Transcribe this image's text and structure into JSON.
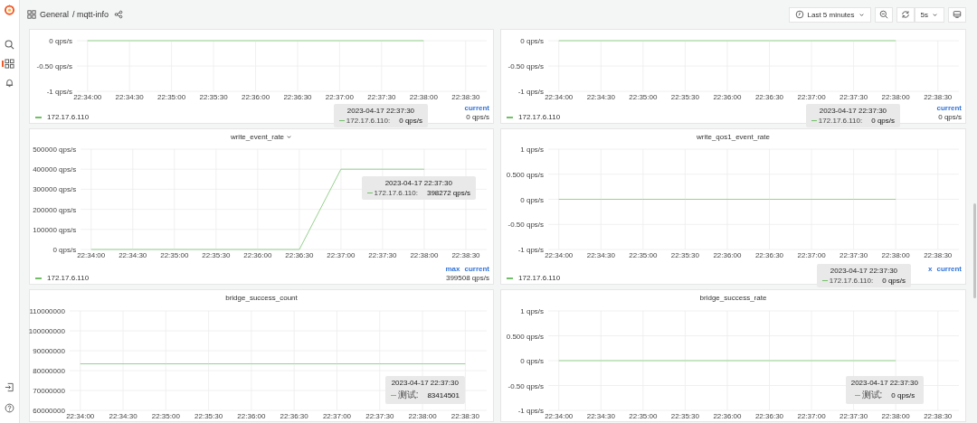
{
  "sidebar": {
    "items": [
      {
        "kind": "search",
        "selected": false
      },
      {
        "kind": "dashboards",
        "selected": true
      },
      {
        "kind": "alerting",
        "selected": false
      }
    ],
    "bottom_items": [
      {
        "kind": "sign-in"
      },
      {
        "kind": "help"
      }
    ]
  },
  "breadcrumb": {
    "folder": "General",
    "dashboard": "/ mqtt-info"
  },
  "toolbar": {
    "time_range": "Last 5 minutes",
    "refresh_interval": "5s"
  },
  "panels": [
    {
      "chart_data": {
        "type": "line",
        "grid": true,
        "categories": [
          "22:34:00",
          "22:34:30",
          "22:35:00",
          "22:35:30",
          "22:36:00",
          "22:36:30",
          "22:37:00",
          "22:37:30",
          "22:38:00",
          "22:38:30"
        ],
        "series": [
          {
            "name": "172.17.6.110",
            "color": "#96d18e",
            "values": [
              0,
              0,
              0,
              0,
              0,
              0,
              0,
              0,
              0,
              null
            ]
          }
        ],
        "ylim": [
          -1,
          0
        ],
        "yticks": [
          {
            "value": 0,
            "label": "0 qps/s"
          },
          {
            "value": -0.5,
            "label": "-0.50 qps/s"
          },
          {
            "value": -1,
            "label": "-1 qps/s"
          }
        ]
      },
      "legend": {
        "color": "#73bf69",
        "headers": [
          "current"
        ],
        "values": [
          "0 qps/s"
        ]
      },
      "tooltip": {
        "time": "2023-04-17 22:37:30",
        "label": "172.17.6.110:",
        "value": "0 qps/s"
      }
    },
    {
      "chart_data": {
        "type": "line",
        "grid": true,
        "categories": [
          "22:34:00",
          "22:34:30",
          "22:35:00",
          "22:35:30",
          "22:36:00",
          "22:36:30",
          "22:37:00",
          "22:37:30",
          "22:38:00",
          "22:38:30"
        ],
        "series": [
          {
            "name": "172.17.6.110",
            "color": "#96d18e",
            "values": [
              0,
              0,
              0,
              0,
              0,
              0,
              0,
              0,
              0,
              null
            ]
          }
        ],
        "ylim": [
          -1,
          0
        ],
        "yticks": [
          {
            "value": 0,
            "label": "0 qps/s"
          },
          {
            "value": -0.5,
            "label": "-0.50 qps/s"
          },
          {
            "value": -1,
            "label": "-1 qps/s"
          }
        ]
      },
      "legend": {
        "color": "#73bf69",
        "headers": [
          "current"
        ],
        "values": [
          "0 qps/s"
        ]
      },
      "tooltip": {
        "time": "2023-04-17 22:37:30",
        "label": "172.17.6.110:",
        "value": "0 qps/s"
      }
    },
    {
      "title": "write_event_rate",
      "hovered": true,
      "chart_data": {
        "type": "line",
        "grid": true,
        "categories": [
          "22:34:00",
          "22:34:30",
          "22:35:00",
          "22:35:30",
          "22:36:00",
          "22:36:30",
          "22:37:00",
          "22:37:30",
          "22:38:00",
          "22:38:30"
        ],
        "series": [
          {
            "name": "172.17.6.110",
            "color": "#96d18e",
            "values": [
              0,
              0,
              0,
              0,
              0,
              0,
              400000,
              400000,
              400000,
              null
            ]
          }
        ],
        "ylim": [
          0,
          500000
        ],
        "yticks": [
          {
            "value": 500000,
            "label": "500000 qps/s"
          },
          {
            "value": 400000,
            "label": "400000 qps/s"
          },
          {
            "value": 300000,
            "label": "300000 qps/s"
          },
          {
            "value": 200000,
            "label": "200000 qps/s"
          },
          {
            "value": 100000,
            "label": "100000 qps/s"
          },
          {
            "value": 0,
            "label": "0 qps/s"
          }
        ]
      },
      "legend": {
        "color": "#73bf69",
        "headers": [
          "max",
          "current"
        ],
        "values": [
          "399508 qps/s"
        ]
      },
      "tooltip": {
        "time": "2023-04-17 22:37:30",
        "label": "172.17.6.110:",
        "value": "398272 qps/s"
      }
    },
    {
      "title": "write_qos1_event_rate",
      "hovered": false,
      "chart_data": {
        "type": "line",
        "grid": true,
        "categories": [
          "22:34:00",
          "22:34:30",
          "22:35:00",
          "22:35:30",
          "22:36:00",
          "22:36:30",
          "22:37:00",
          "22:37:30",
          "22:38:00",
          "22:38:30"
        ],
        "series": [
          {
            "name": "172.17.6.110",
            "color": "#96d18e",
            "values": [
              0,
              0,
              0,
              0,
              0,
              0,
              0,
              0,
              0,
              null
            ]
          }
        ],
        "ylim": [
          -1,
          1
        ],
        "yticks": [
          {
            "value": 1,
            "label": "1 qps/s"
          },
          {
            "value": 0.5,
            "label": "0.500 qps/s"
          },
          {
            "value": 0,
            "label": "0 qps/s"
          },
          {
            "value": -0.5,
            "label": "-0.50 qps/s"
          },
          {
            "value": -1,
            "label": "-1 qps/s"
          }
        ]
      },
      "legend": {
        "color": "#73bf69",
        "headers": [
          "x",
          "current"
        ]
      },
      "tooltip": {
        "time": "2023-04-17 22:37:30",
        "label": "172.17.6.110:",
        "value": "0 qps/s"
      }
    },
    {
      "title": "bridge_success_count",
      "hovered": false,
      "chart_data": {
        "type": "line",
        "grid": true,
        "categories": [
          "22:34:00",
          "22:34:30",
          "22:35:00",
          "22:35:30",
          "22:36:00",
          "22:36:30",
          "22:37:00",
          "22:37:30",
          "22:38:00",
          "22:38:30"
        ],
        "series": [
          {
            "color": "#96d18e",
            "values": [
              83400000,
              83400000,
              83400000,
              83400000,
              83400000,
              83400000,
              83400000,
              83400000,
              83400000,
              83400000
            ]
          }
        ],
        "ylim": [
          60000000,
          110000000
        ],
        "yticks": [
          110000000,
          100000000,
          90000000,
          80000000,
          70000000,
          60000000
        ]
      },
      "tooltip": {
        "time": "2023-04-17 22:37:30",
        "label": "测试:",
        "value": "83414501"
      }
    },
    {
      "title": "bridge_success_rate",
      "hovered": false,
      "chart_data": {
        "type": "line",
        "grid": true,
        "categories": [
          "22:34:00",
          "22:34:30",
          "22:35:00",
          "22:35:30",
          "22:36:00",
          "22:36:30",
          "22:37:00",
          "22:37:30",
          "22:38:00",
          "22:38:30"
        ],
        "series": [
          {
            "color": "#96d18e",
            "values": [
              0,
              0,
              0,
              0,
              0,
              0,
              0,
              0,
              0,
              null
            ]
          }
        ],
        "ylim": [
          -1,
          1
        ],
        "yticks": [
          {
            "value": 1,
            "label": "1 qps/s"
          },
          {
            "value": 0.5,
            "label": "0.500 qps/s"
          },
          {
            "value": 0,
            "label": "0 qps/s"
          },
          {
            "value": -0.5,
            "label": "-0.50 qps/s"
          },
          {
            "value": -1,
            "label": "-1 qps/s"
          }
        ]
      },
      "tooltip": {
        "time": "2023-04-17 22:37:30",
        "label": "测试:",
        "value": "0 qps/s"
      }
    }
  ]
}
